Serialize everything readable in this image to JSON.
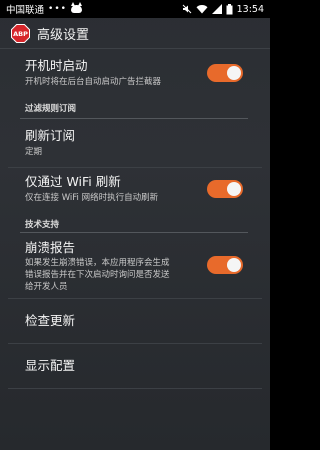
{
  "status_bar": {
    "carrier": "中国联通",
    "dots": "•••",
    "time": "13:54",
    "icons": [
      "cat-notification-icon",
      "mute-icon",
      "wifi-icon",
      "signal-icon",
      "battery-icon"
    ]
  },
  "app_bar": {
    "logo_text": "ABP",
    "title": "高级设置"
  },
  "prefs": {
    "autostart": {
      "title": "开机时启动",
      "summary": "开机时将在后台自动启动广告拦截器",
      "enabled": true
    },
    "section_filters": {
      "title": "过滤规则订阅"
    },
    "refresh": {
      "title": "刷新订阅",
      "summary": "定期"
    },
    "wifi_only": {
      "title": "仅通过 WiFi 刷新",
      "summary": "仅在连接 WiFi 网络时执行自动刷新",
      "enabled": true
    },
    "section_support": {
      "title": "技术支持"
    },
    "crash_report": {
      "title": "崩溃报告",
      "summary_lines": [
        "如果发生崩溃错误，本应用程序会生成",
        "错误报告并在下次启动时询问是否发送",
        "给开发人员"
      ],
      "enabled": true
    },
    "check_update": {
      "title": "检查更新"
    },
    "show_config": {
      "title": "显示配置"
    }
  },
  "colors": {
    "accent": "#e86a2b",
    "background": "#2b2e33",
    "logo_red": "#d7262b"
  }
}
